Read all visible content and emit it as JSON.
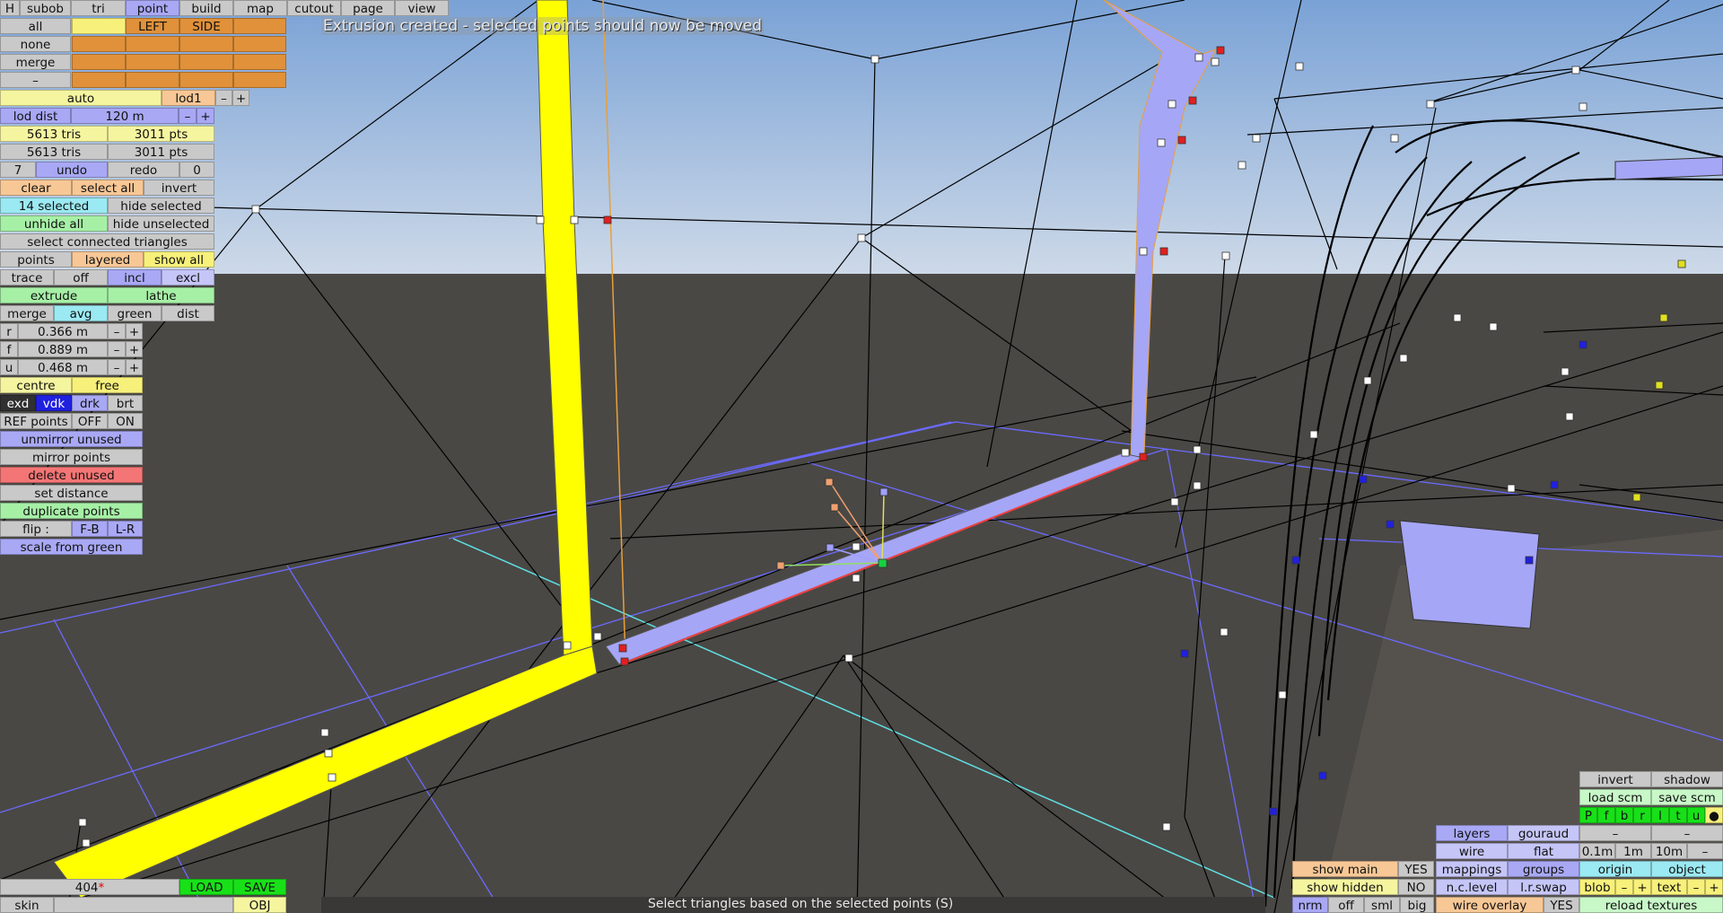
{
  "colors": {
    "sky_top": "#7ea5d8",
    "sky_bottom": "#c8d6e8",
    "floor": "#4a4844",
    "yellow": "#ffff00",
    "selection": "#a6a6f7",
    "grid": "#6a6aff",
    "wire": "#000000"
  },
  "status": {
    "message": "Extrusion created - selected points should now be moved",
    "hint": "Select triangles based on the selected points (S)"
  },
  "top_tabs": [
    "H",
    "subob",
    "tri",
    "point",
    "build",
    "map",
    "cutout",
    "page",
    "view"
  ],
  "select_rows": {
    "all": "all",
    "none": "none",
    "merge": "merge",
    "dash": "–",
    "left": "LEFT",
    "side": "SIDE"
  },
  "lod": {
    "auto": "auto",
    "lod1": "lod1",
    "minus": "–",
    "plus": "+",
    "dist_label": "lod dist",
    "dist_value": "120 m"
  },
  "stats": {
    "tris1": "5613 tris",
    "pts1": "3011 pts",
    "tris2": "5613 tris",
    "pts2": "3011 pts"
  },
  "undo": {
    "count": "7",
    "undo": "undo",
    "redo": "redo",
    "zero": "0"
  },
  "selection": {
    "clear": "clear",
    "select_all": "select all",
    "invert": "invert",
    "selected": "14 selected",
    "hide_selected": "hide selected",
    "unhide_all": "unhide all",
    "hide_unselected": "hide unselected",
    "select_connected": "select connected triangles"
  },
  "view_opts": {
    "points": "points",
    "layered": "layered",
    "show_all": "show all",
    "trace": "trace",
    "off": "off",
    "incl": "incl",
    "excl": "excl"
  },
  "tools": {
    "extrude": "extrude",
    "lathe": "lathe",
    "merge": "merge",
    "avg": "avg",
    "green": "green",
    "dist": "dist"
  },
  "values": [
    {
      "label": "r",
      "value": "0.366 m"
    },
    {
      "label": "f",
      "value": "0.889 m"
    },
    {
      "label": "u",
      "value": "0.468 m"
    }
  ],
  "centre": {
    "centre": "centre",
    "free": "free"
  },
  "brightness": {
    "exd": "exd",
    "vdk": "vdk",
    "drk": "drk",
    "brt": "brt"
  },
  "ref": {
    "label": "REF points",
    "off": "OFF",
    "on": "ON"
  },
  "actions": {
    "unmirror": "unmirror unused",
    "mirror": "mirror points",
    "delete": "delete unused",
    "set_distance": "set distance",
    "duplicate": "duplicate points",
    "flip": "flip :",
    "fb": "F-B",
    "lr": "L-R",
    "scale": "scale from green"
  },
  "bottom_left": {
    "count": "404",
    "star": "*",
    "load": "LOAD",
    "save": "SAVE",
    "skin": "skin",
    "obj": "OBJ"
  },
  "bottom_right": {
    "show_main": "show main",
    "yes1": "YES",
    "show_hidden": "show hidden",
    "no": "NO",
    "nrm": "nrm",
    "off": "off",
    "sml": "sml",
    "big": "big",
    "layers": "layers",
    "gouraud": "gouraud",
    "wire": "wire",
    "flat": "flat",
    "mappings": "mappings",
    "groups": "groups",
    "nclevel": "n.c.level",
    "lrswap": "l.r.swap",
    "wire_overlay": "wire overlay",
    "yes2": "YES",
    "invert": "invert",
    "shadow": "shadow",
    "load_scm": "load scm",
    "save_scm": "save scm",
    "letters": [
      "P",
      "f",
      "b",
      "r",
      "l",
      "t",
      "u"
    ],
    "dot": "●",
    "dash1": "–",
    "dash2": "–",
    "s01": "0.1m",
    "s1": "1m",
    "s10": "10m",
    "sminus": "–",
    "origin": "origin",
    "object": "object",
    "blob": "blob",
    "bminus": "–",
    "bplus": "+",
    "text": "text",
    "tminus": "–",
    "tplus": "+",
    "reload": "reload textures"
  }
}
